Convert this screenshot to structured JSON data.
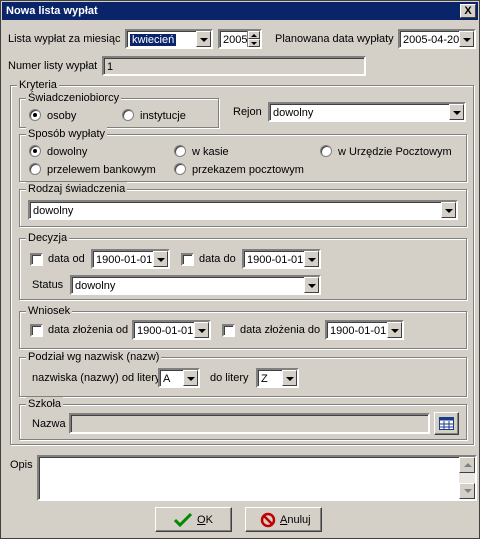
{
  "window": {
    "title": "Nowa lista wypłat",
    "close": "X"
  },
  "top": {
    "month_label": "Lista wypłat za miesiąc",
    "month_value": "kwiecień",
    "year_value": "2005",
    "planned_label": "Planowana data wypłaty",
    "planned_value": "2005-04-20",
    "number_label": "Numer listy wypłat",
    "number_value": "1"
  },
  "criteria": {
    "title": "Kryteria",
    "beneficiaries": {
      "title": "Świadczeniobiorcy",
      "option1": "osoby",
      "option2": "instytucje",
      "selected": "osoby"
    },
    "region": {
      "label": "Rejon",
      "value": "dowolny"
    },
    "payment_method": {
      "title": "Sposób wypłaty",
      "options": [
        "dowolny",
        "w kasie",
        "w Urzędzie Pocztowym",
        "przelewem bankowym",
        "przekazem pocztowym"
      ],
      "selected": "dowolny"
    },
    "benefit_type": {
      "title": "Rodzaj świadczenia",
      "value": "dowolny"
    },
    "decision": {
      "title": "Decyzja",
      "from_label": "data od",
      "from_value": "1900-01-01",
      "to_label": "data do",
      "to_value": "1900-01-01",
      "status_label": "Status",
      "status_value": "dowolny"
    },
    "application": {
      "title": "Wniosek",
      "from_label": "data złożenia od",
      "from_value": "1900-01-01",
      "to_label": "data złożenia do",
      "to_value": "1900-01-01"
    },
    "names": {
      "title": "Podział wg nazwisk (nazw)",
      "from_label": "nazwiska (nazwy) od litery",
      "from_value": "A",
      "to_label": "do litery",
      "to_value": "Z"
    },
    "school": {
      "title": "Szkoła",
      "name_label": "Nazwa",
      "name_value": ""
    }
  },
  "notes": {
    "label": "Opis",
    "value": ""
  },
  "buttons": {
    "ok_underline": "O",
    "ok_rest": "K",
    "cancel_underline": "A",
    "cancel_rest": "nuluj"
  }
}
